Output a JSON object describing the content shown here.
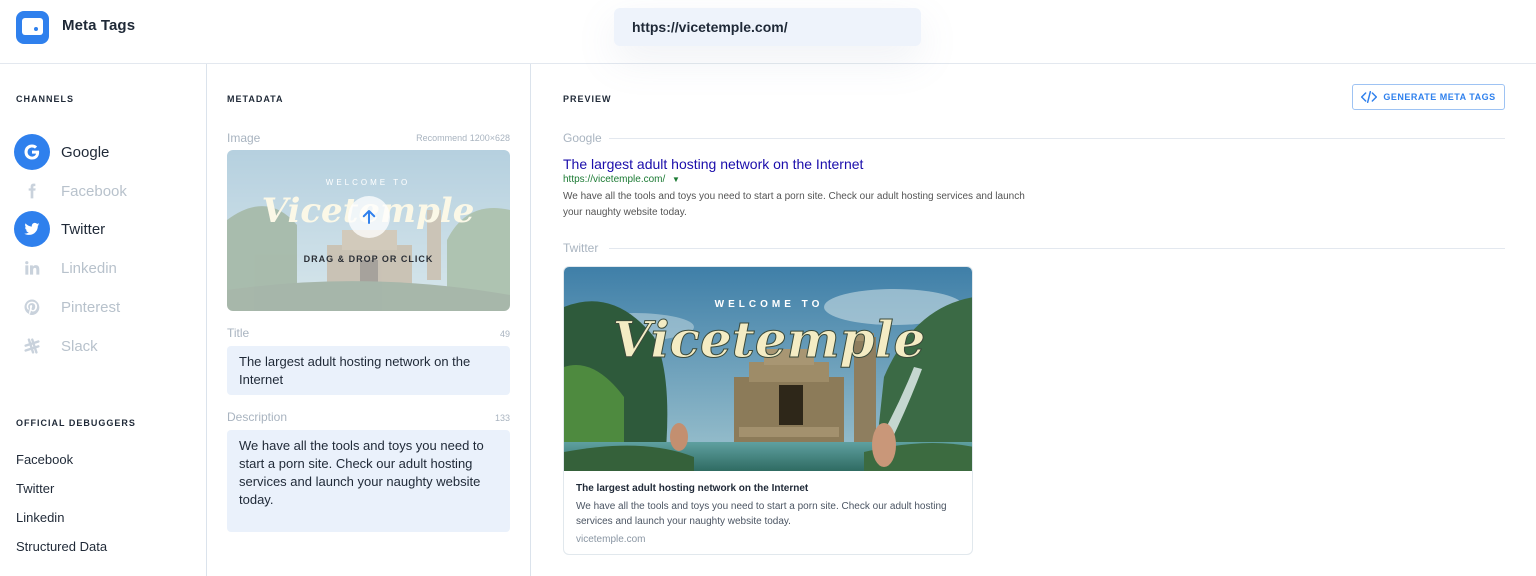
{
  "app": {
    "title": "Meta Tags"
  },
  "url_bar": {
    "value": "https://vicetemple.com/"
  },
  "sidebar": {
    "channels_label": "CHANNELS",
    "channels": [
      {
        "label": "Google",
        "icon": "google-icon",
        "active": true
      },
      {
        "label": "Facebook",
        "icon": "facebook-icon",
        "active": false
      },
      {
        "label": "Twitter",
        "icon": "twitter-icon",
        "active": true
      },
      {
        "label": "Linkedin",
        "icon": "linkedin-icon",
        "active": false
      },
      {
        "label": "Pinterest",
        "icon": "pinterest-icon",
        "active": false
      },
      {
        "label": "Slack",
        "icon": "slack-icon",
        "active": false
      }
    ],
    "debuggers_label": "OFFICIAL DEBUGGERS",
    "debuggers": [
      "Facebook",
      "Twitter",
      "Linkedin",
      "Structured Data"
    ]
  },
  "metadata": {
    "label": "METADATA",
    "image_label": "Image",
    "image_hint": "Recommend 1200×628",
    "drop_text": "DRAG & DROP OR CLICK",
    "title_label": "Title",
    "title_count": "49",
    "title_value": "The largest adult hosting network on the Internet",
    "description_label": "Description",
    "description_count": "133",
    "description_value": "We have all the tools and toys you need to start a porn site. Check our adult hosting services and launch your naughty website today."
  },
  "preview": {
    "label": "PREVIEW",
    "generate_button": "GENERATE META TAGS",
    "google_label": "Google",
    "google_title": "The largest adult hosting network on the Internet",
    "google_url": "https://vicetemple.com/",
    "google_desc": "We have all the tools and toys you need to start a porn site. Check our adult hosting services and launch your naughty website today.",
    "twitter_label": "Twitter",
    "card_image_welcome": "WELCOME TO",
    "card_image_brand": "Vicetemple",
    "card_title": "The largest adult hosting network on the Internet",
    "card_desc": "We have all the tools and toys you need to start a porn site. Check our adult hosting services and launch your naughty website today.",
    "card_domain": "vicetemple.com"
  },
  "colors": {
    "accent": "#2f80ed",
    "google_link": "#1a0dab",
    "google_url": "#1c7b34",
    "field_bg": "#eaf1fb"
  }
}
